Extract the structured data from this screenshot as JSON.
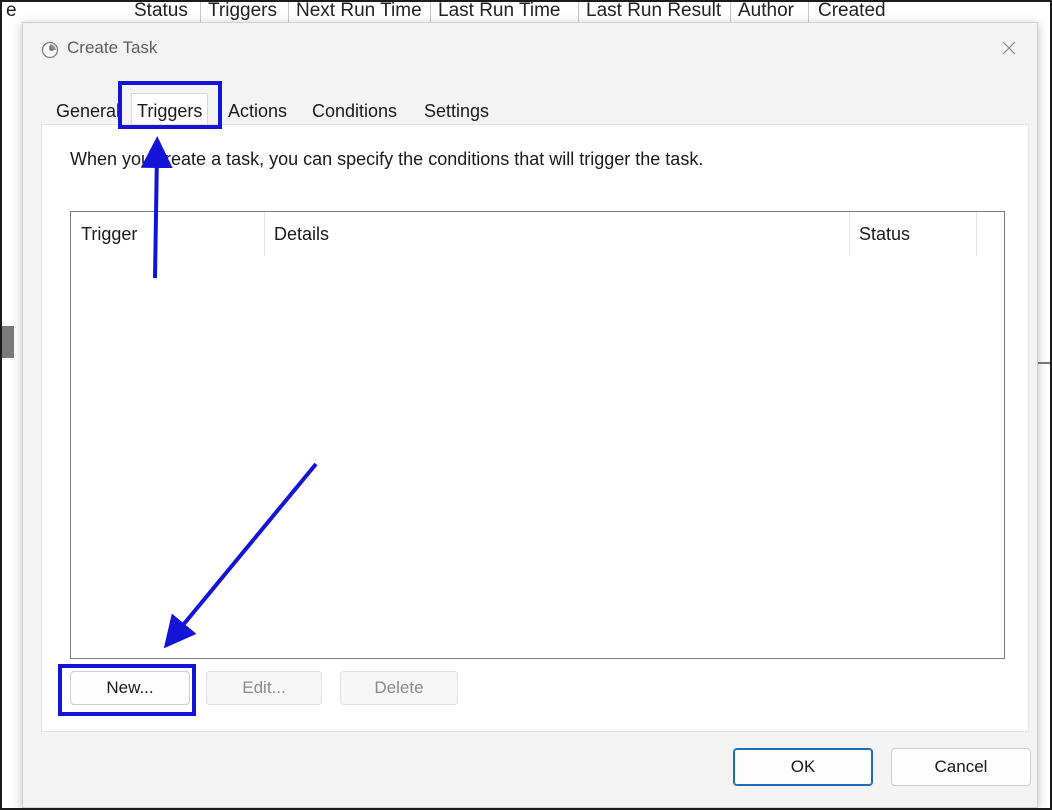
{
  "background_app": {
    "columns": [
      "e",
      "Status",
      "Triggers",
      "Next Run Time",
      "Last Run Time",
      "Last Run Result",
      "Author",
      "Created"
    ]
  },
  "dialog": {
    "title": "Create Task",
    "tabs": [
      {
        "label": "General",
        "active": false
      },
      {
        "label": "Triggers",
        "active": true
      },
      {
        "label": "Actions",
        "active": false
      },
      {
        "label": "Conditions",
        "active": false
      },
      {
        "label": "Settings",
        "active": false
      }
    ],
    "description": "When you create a task, you can specify the conditions that will trigger the task.",
    "list": {
      "columns": [
        "Trigger",
        "Details",
        "Status"
      ],
      "rows": []
    },
    "buttons": {
      "new": "New...",
      "edit": "Edit...",
      "delete": "Delete",
      "ok": "OK",
      "cancel": "Cancel"
    }
  },
  "icons": {
    "title": "clock-icon",
    "close": "close-icon"
  },
  "colors": {
    "annotation": "#1414d6",
    "accent": "#1f6bb3"
  }
}
